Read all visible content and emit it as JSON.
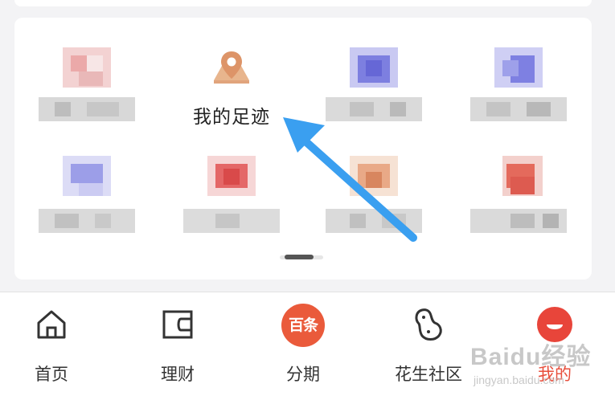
{
  "grid": {
    "footprint_label": "我的足迹",
    "footprint_icon": "location-pin-icon"
  },
  "tabbar": {
    "tabs": [
      {
        "label": "首页",
        "icon": "home-icon"
      },
      {
        "label": "理财",
        "icon": "wallet-icon"
      },
      {
        "label": "分期",
        "icon": "baichuan-icon",
        "badge_text": "百条"
      },
      {
        "label": "花生社区",
        "icon": "peanut-icon"
      },
      {
        "label": "我的",
        "icon": "mine-icon",
        "active": true
      }
    ]
  },
  "watermark": {
    "text": "Baidu经验",
    "sub": "jingyan.baidu.com"
  },
  "colors": {
    "accent": "#e84f3d",
    "annotation_arrow": "#3a9ff0"
  }
}
